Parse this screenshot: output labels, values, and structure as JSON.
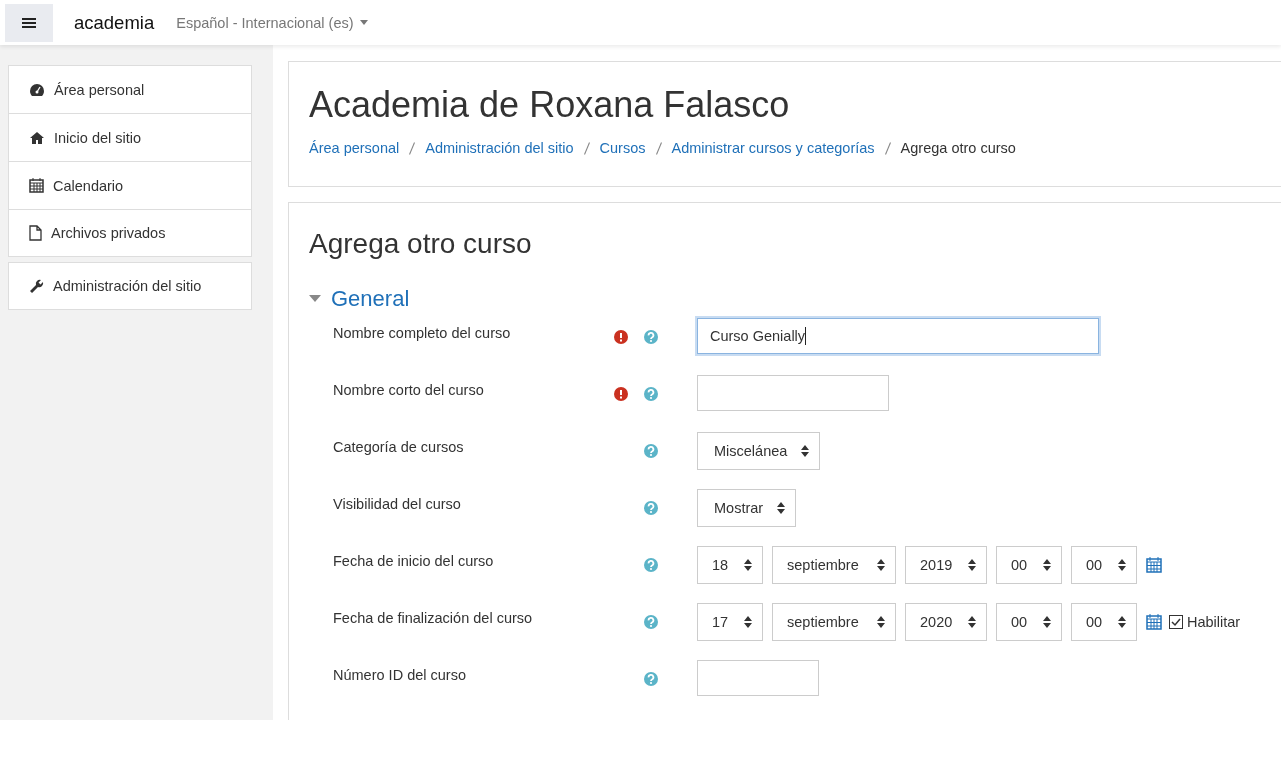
{
  "navbar": {
    "site_name": "academia",
    "language": "Español - Internacional (es)"
  },
  "sidebar": {
    "groups": [
      [
        {
          "label": "Área personal"
        },
        {
          "label": "Inicio del sitio"
        },
        {
          "label": "Calendario"
        },
        {
          "label": "Archivos privados"
        }
      ],
      [
        {
          "label": "Administración del sitio"
        }
      ]
    ]
  },
  "header": {
    "title": "Academia de Roxana Falasco",
    "breadcrumb": [
      {
        "label": "Área personal",
        "link": true
      },
      {
        "label": "Administración del sitio",
        "link": true
      },
      {
        "label": "Cursos",
        "link": true
      },
      {
        "label": "Administrar cursos y categorías",
        "link": true
      },
      {
        "label": "Agrega otro curso",
        "link": false
      }
    ]
  },
  "form": {
    "title": "Agrega otro curso",
    "section": {
      "title": "General",
      "expanded": true
    },
    "fields": [
      {
        "kind": "text",
        "label": "Nombre completo del curso",
        "required": true,
        "value": "Curso Genially",
        "focused": true
      },
      {
        "kind": "text",
        "label": "Nombre corto del curso",
        "required": true,
        "focused": false
      },
      {
        "kind": "select",
        "label": "Categoría de cursos",
        "required": false,
        "value": "Miscelánea"
      },
      {
        "kind": "select",
        "label": "Visibilidad del curso",
        "required": false,
        "value": "Mostrar"
      },
      {
        "kind": "date",
        "label": "Fecha de inicio del curso",
        "required": false,
        "parts": [
          "18",
          "septiembre",
          "2019",
          "00",
          "00"
        ]
      },
      {
        "kind": "date",
        "label": "Fecha de finalización del curso",
        "required": false,
        "parts": [
          "17",
          "septiembre",
          "2020",
          "00",
          "00"
        ],
        "enable": {
          "label": "Habilitar",
          "checked": true
        }
      },
      {
        "kind": "text",
        "label": "Número ID del curso",
        "required": false,
        "focused": false
      }
    ]
  }
}
